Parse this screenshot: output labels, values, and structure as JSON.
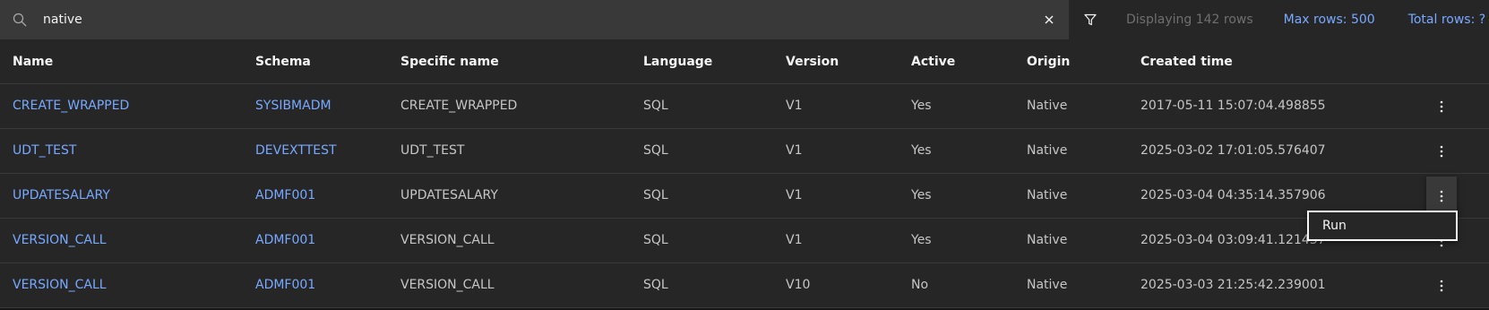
{
  "search": {
    "value": "native",
    "placeholder": ""
  },
  "toolbar": {
    "displaying": "Displaying 142 rows",
    "max_rows": "Max rows: 500",
    "total_rows": "Total rows: ?"
  },
  "columns": [
    "Name",
    "Schema",
    "Specific name",
    "Language",
    "Version",
    "Active",
    "Origin",
    "Created time"
  ],
  "rows": [
    {
      "name": "CREATE_WRAPPED",
      "schema": "SYSIBMADM",
      "specific": "CREATE_WRAPPED",
      "language": "SQL",
      "version": "V1",
      "active": "Yes",
      "origin": "Native",
      "created": "2017-05-11 15:07:04.498855"
    },
    {
      "name": "UDT_TEST",
      "schema": "DEVEXTTEST",
      "specific": "UDT_TEST",
      "language": "SQL",
      "version": "V1",
      "active": "Yes",
      "origin": "Native",
      "created": "2025-03-02 17:01:05.576407"
    },
    {
      "name": "UPDATESALARY",
      "schema": "ADMF001",
      "specific": "UPDATESALARY",
      "language": "SQL",
      "version": "V1",
      "active": "Yes",
      "origin": "Native",
      "created": "2025-03-04 04:35:14.357906"
    },
    {
      "name": "VERSION_CALL",
      "schema": "ADMF001",
      "specific": "VERSION_CALL",
      "language": "SQL",
      "version": "V1",
      "active": "Yes",
      "origin": "Native",
      "created": "2025-03-04 03:09:41.121437"
    },
    {
      "name": "VERSION_CALL",
      "schema": "ADMF001",
      "specific": "VERSION_CALL",
      "language": "SQL",
      "version": "V10",
      "active": "No",
      "origin": "Native",
      "created": "2025-03-03 21:25:42.239001"
    }
  ],
  "menu": {
    "items": [
      "Run"
    ]
  },
  "icons": {
    "search": "search-icon",
    "clear": "close-icon",
    "filter": "filter-icon",
    "overflow": "overflow-menu-vertical-icon"
  },
  "colors": {
    "link": "#78a9ff",
    "text": "#c6c6c6",
    "header_text": "#f4f4f4",
    "row_bg": "#262626",
    "search_bg": "#393939",
    "muted": "#6f6f6f"
  }
}
